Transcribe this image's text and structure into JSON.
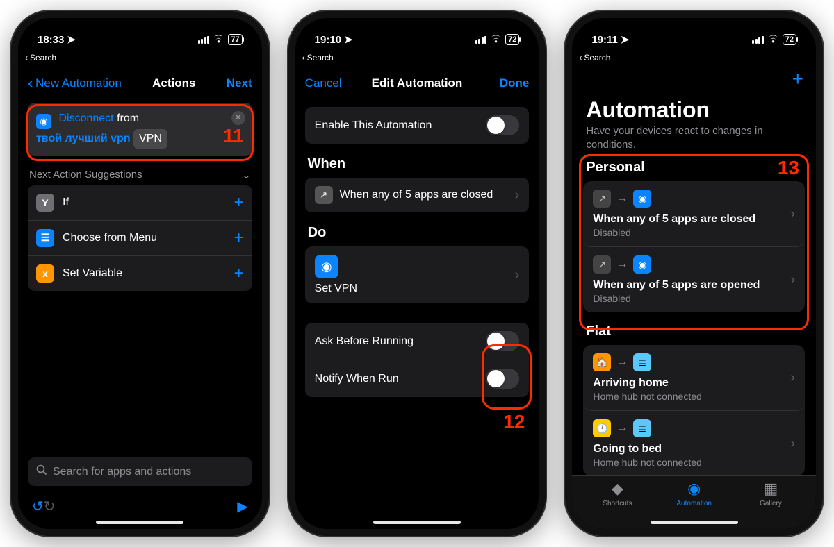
{
  "p1": {
    "time": "18:33",
    "batt": "77",
    "breadcrumb": "Search",
    "back": "New Automation",
    "title": "Actions",
    "next": "Next",
    "action": {
      "disconnect": "Disconnect",
      "from": "from",
      "vpn_name": "твой лучший vpn",
      "vpn_label": "VPN"
    },
    "suggest_head": "Next Action Suggestions",
    "suggs": [
      {
        "label": "If"
      },
      {
        "label": "Choose from Menu"
      },
      {
        "label": "Set Variable"
      }
    ],
    "search_ph": "Search for apps and actions",
    "hl_num": "11"
  },
  "p2": {
    "time": "19:10",
    "batt": "72",
    "breadcrumb": "Search",
    "cancel": "Cancel",
    "title": "Edit Automation",
    "done": "Done",
    "enable": "Enable This Automation",
    "when": "When",
    "when_desc": "When any of 5 apps are closed",
    "do": "Do",
    "do_label": "Set VPN",
    "ask": "Ask Before Running",
    "notify": "Notify When Run",
    "hl_num": "12"
  },
  "p3": {
    "time": "19:11",
    "batt": "72",
    "breadcrumb": "Search",
    "title": "Automation",
    "sub": "Have your devices react to changes in conditions.",
    "personal": "Personal",
    "autos": [
      {
        "title": "When any of 5 apps are closed",
        "sub": "Disabled"
      },
      {
        "title": "When any of 5 apps are opened",
        "sub": "Disabled"
      }
    ],
    "flat": "Flat",
    "home_autos": [
      {
        "title": "Arriving home",
        "sub": "Home hub not connected"
      },
      {
        "title": "Going to bed",
        "sub": "Home hub not connected"
      }
    ],
    "tabs": {
      "shortcuts": "Shortcuts",
      "automation": "Automation",
      "gallery": "Gallery"
    },
    "hl_num": "13"
  }
}
